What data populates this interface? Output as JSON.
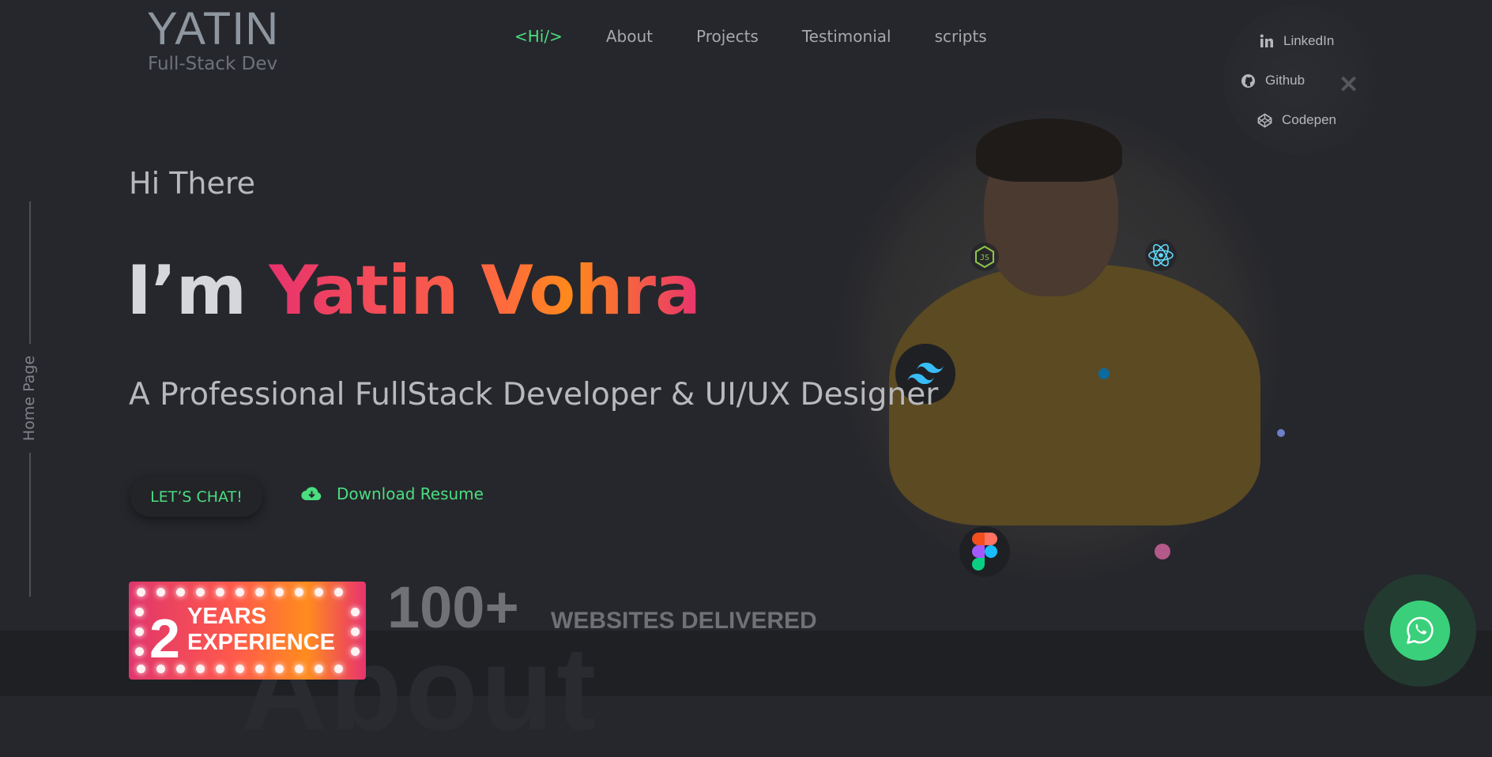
{
  "logo": {
    "name": "YATIN",
    "subtitle": "Full-Stack Dev"
  },
  "nav": {
    "items": [
      {
        "label": "<Hi/>",
        "active": true
      },
      {
        "label": "About"
      },
      {
        "label": "Projects"
      },
      {
        "label": "Testimonial"
      },
      {
        "label": "scripts"
      }
    ]
  },
  "social": {
    "items": [
      {
        "label": "LinkedIn",
        "icon": "linkedin-icon"
      },
      {
        "label": "Github",
        "icon": "github-icon"
      },
      {
        "label": "Codepen",
        "icon": "codepen-icon"
      }
    ],
    "close_icon": "close-icon"
  },
  "side": {
    "label": "Home Page"
  },
  "hero": {
    "greeting": "Hi There",
    "im": "I’m",
    "name": "Yatin Vohra",
    "tagline": "A Professional FullStack Developer & UI/UX Designer",
    "chat_label": "LET’S CHAT!",
    "resume_label": "Download Resume"
  },
  "tech_icons": [
    "javascript-icon",
    "react-icon",
    "tailwind-icon",
    "figma-icon"
  ],
  "stats": {
    "years_number": "2",
    "years_label": "YEARS",
    "experience_label": "EXPERIENCE",
    "count": "100+",
    "count_label": "WEBSITES DELIVERED"
  },
  "next_section_heading": "About",
  "colors": {
    "accent": "#4ade80",
    "gradient_start": "#e8336e",
    "gradient_end": "#ff8a1a",
    "background": "#26272c"
  },
  "whatsapp": {
    "icon": "whatsapp-icon"
  }
}
